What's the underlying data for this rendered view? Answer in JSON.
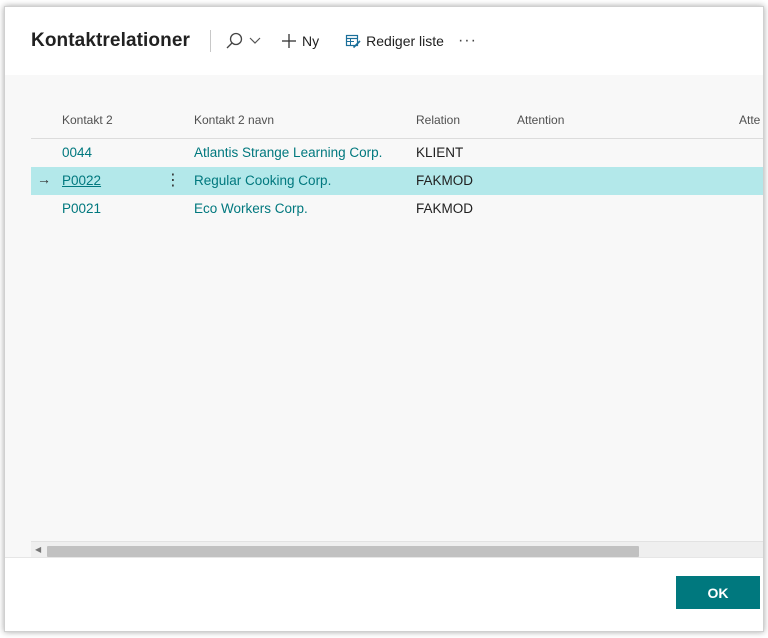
{
  "dialog": {
    "title": "Kontaktrelationer"
  },
  "toolbar": {
    "search_icon": "search-icon",
    "new_label": "Ny",
    "edit_list_label": "Rediger liste",
    "more_label": "···"
  },
  "table": {
    "columns": [
      "Kontakt 2",
      "Kontakt 2 navn",
      "Relation",
      "Attention",
      "Atte"
    ],
    "rows": [
      {
        "kontakt2": "0044",
        "navn": "Atlantis Strange Learning Corp.",
        "relation": "KLIENT",
        "attention": ""
      },
      {
        "kontakt2": "P0022",
        "navn": "Regular Cooking Corp.",
        "relation": "FAKMOD",
        "attention": ""
      },
      {
        "kontakt2": "P0021",
        "navn": "Eco Workers Corp.",
        "relation": "FAKMOD",
        "attention": ""
      }
    ],
    "selected_row_marker": "→",
    "row_menu_glyph": "⋮"
  },
  "footer": {
    "ok_label": "OK"
  },
  "colors": {
    "accent": "#00787e",
    "selected_row": "#b3e8ea",
    "content_bg": "#f8f8f8"
  }
}
